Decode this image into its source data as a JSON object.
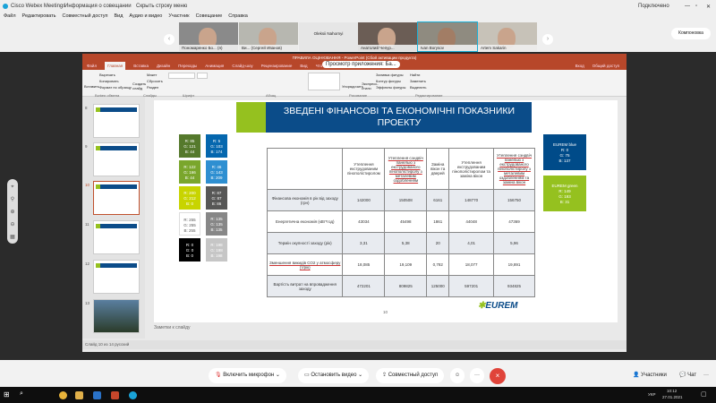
{
  "app": {
    "title": "Cisco Webex Meetings",
    "info": "Информация о совещании",
    "hide_menu": "Скрыть строку меню",
    "status": "Подключено",
    "layout": "Компоновка"
  },
  "menu": [
    "Файл",
    "Редактировать",
    "Совместный доступ",
    "Вид",
    "Аудио и видео",
    "Участник",
    "Совещание",
    "Справка"
  ],
  "participants": [
    {
      "name": "Пономаренко Бо... (я)",
      "video": true
    },
    {
      "name": "Ви... (Сергей Иванов)",
      "video": true
    },
    {
      "name": "Oleksii Nahornyi",
      "video": false
    },
    {
      "name": "Анатолий Чепур...",
      "video": true
    },
    {
      "name": "Ivan Borysov",
      "video": true,
      "active": true
    },
    {
      "name": "Artem Sakarin",
      "video": true
    }
  ],
  "ppt": {
    "title": "ПРАВИЛА ОЦІНЮВАННЯ - PowerPoint (Сбой активации продукта)",
    "tabs": [
      "Файл",
      "Главная",
      "Вставка",
      "Дизайн",
      "Переходы",
      "Анимация",
      "Слайд-шоу",
      "Рецензирование",
      "Вид",
      "Что вы хотите сделать?"
    ],
    "right_tabs": [
      "Вход",
      "Общий доступ"
    ],
    "tooltip": "Просмотр приложения: Ба...",
    "ribbon_groups": [
      "Буфер обмена",
      "Слайды",
      "Шрифт",
      "Абзац",
      "Рисование",
      "Редактирование"
    ],
    "ribbon_items": [
      "Вставить",
      "Вырезать",
      "Копировать",
      "Формат по образцу",
      "Создать слайд",
      "Макет",
      "Сбросить",
      "Раздел",
      "Упорядочить",
      "Экспресс-стили",
      "Заливка фигуры",
      "Контур фигуры",
      "Эффекты фигуры",
      "Найти",
      "Заменить",
      "Выделить"
    ],
    "slide_numbers": [
      "8",
      "9",
      "10",
      "11",
      "12",
      "13"
    ],
    "current_slide": "10",
    "notes": "Заметки к слайду",
    "status": "Слайд 10 из 14   русский"
  },
  "slide": {
    "title": "ЗВЕДЕНІ ФІНАНСОВІ ТА ЕКОНОМІЧНІ ПОКАЗНИКИ ПРОЕКТУ",
    "page": "10",
    "logo": "EUREM",
    "swatches": [
      {
        "text": [
          "R: 85",
          "G: 121",
          "B: 44"
        ],
        "color": "#55792c"
      },
      {
        "text": [
          "R: 5",
          "G: 103",
          "B: 174"
        ],
        "color": "#0567ae"
      },
      {
        "text": [
          "R: 122",
          "G: 166",
          "B: 44"
        ],
        "color": "#7aa62c"
      },
      {
        "text": [
          "R: 46",
          "G: 143",
          "B: 209"
        ],
        "color": "#2e8fd1"
      },
      {
        "text": [
          "R: 200",
          "G: 212",
          "B: 0"
        ],
        "color": "#c8d400"
      },
      {
        "text": [
          "R: 87",
          "G: 87",
          "B: 86"
        ],
        "color": "#575756"
      },
      {
        "text": [
          "R: 255",
          "G: 255",
          "B: 255"
        ],
        "color": "#ffffff"
      },
      {
        "text": [
          "R: 135",
          "G: 135",
          "B: 135"
        ],
        "color": "#878787"
      },
      {
        "text": [
          "R: 0",
          "G: 0",
          "B: 0"
        ],
        "color": "#000000"
      },
      {
        "text": [
          "R: 198",
          "G: 198",
          "B: 198"
        ],
        "color": "#c6c6c6"
      }
    ],
    "brand": [
      {
        "text": [
          "EUREM blue",
          "R: 0",
          "G: 75",
          "B: 137"
        ],
        "color": "#004b89"
      },
      {
        "text": [
          "EUREM green",
          "R: 149",
          "G: 193",
          "B: 31"
        ],
        "color": "#95c11f"
      }
    ],
    "table": {
      "headers": [
        "",
        "Утеплення екструдованим пінополістиролом",
        "Утеплення сэндвіч панелью з екструдованого пінополістиролу з металевим оздобленням",
        "Заміна вікон та дверей",
        "Утеплення екструдованим пінополістиролом та заміна вікон",
        "Утеплення сэндвіч панелью з екструдованого пінополістиролу з металевим оздобленням та заміна вікон"
      ],
      "rows": [
        [
          "Фінансова економія в рік від заходу (грн)",
          "142000",
          "150508",
          "6161",
          "148770",
          "156750"
        ],
        [
          "Енергетична економія (кВт*год)",
          "43034",
          "45498",
          "1861",
          "44048",
          "47369"
        ],
        [
          "Термін окупності заходу (рік)",
          "3,31",
          "5,38",
          "20",
          "4,01",
          "5,96"
        ],
        [
          "Зменшення викидів СО2 у атмосферу (т/рік)",
          "18,085",
          "19,109",
          "0,782",
          "18,077",
          "19,891"
        ],
        [
          "Вартість витрат на впровадження заходу",
          "472201",
          "809825",
          "125000",
          "597201",
          "934825"
        ]
      ]
    }
  },
  "controls": {
    "mic": "Включить микрофон",
    "video": "Остановить видео",
    "share": "Совместный доступ",
    "more": "···",
    "end": "×",
    "participants": "Участники",
    "chat": "Чат"
  },
  "taskbar": {
    "time": "10:12",
    "date": "27.01.2021",
    "lang": "УКР"
  }
}
